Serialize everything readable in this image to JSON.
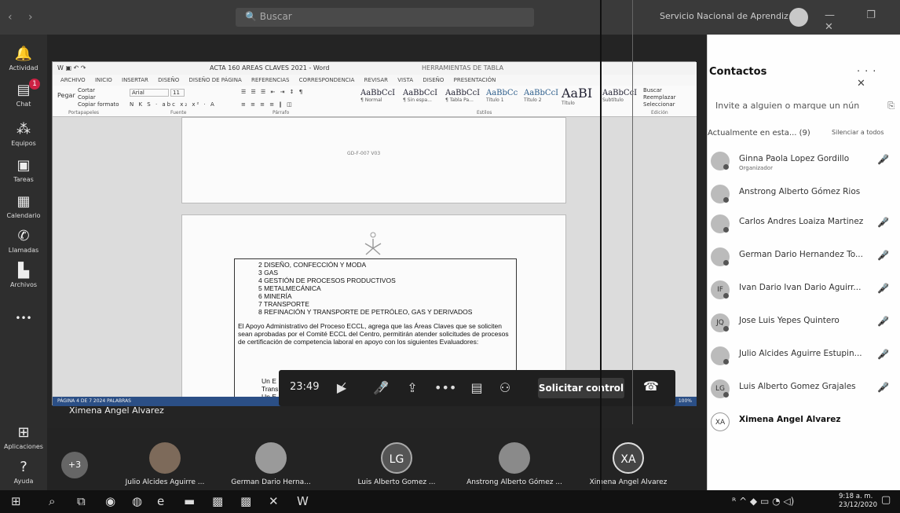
{
  "titlebar": {
    "search": "Buscar",
    "org": "Servicio Nacional de Aprendiz...",
    "nav": "‹ ›",
    "win": "— ❐ ✕"
  },
  "rail": {
    "items": [
      {
        "label": "Actividad",
        "icon": "bell-icon",
        "glyph": "🔔"
      },
      {
        "label": "Chat",
        "icon": "chat-icon",
        "glyph": "▤",
        "badge": "1"
      },
      {
        "label": "Equipos",
        "icon": "teams-icon",
        "glyph": "⁂"
      },
      {
        "label": "Tareas",
        "icon": "tasks-icon",
        "glyph": "▣"
      },
      {
        "label": "Calendario",
        "icon": "calendar-icon",
        "glyph": "▦"
      },
      {
        "label": "Llamadas",
        "icon": "phone-icon",
        "glyph": "✆"
      },
      {
        "label": "Archivos",
        "icon": "files-icon",
        "glyph": "▙"
      },
      {
        "label": "...",
        "icon": "more-icon",
        "glyph": "•••"
      }
    ],
    "apps": "Aplicaciones",
    "help": "Ayuda"
  },
  "word": {
    "title": "ACTA 160 AREAS CLAVES 2021 - Word",
    "tools": "HERRAMIENTAS DE TABLA",
    "menus": [
      "ARCHIVO",
      "INICIO",
      "INSERTAR",
      "DISEÑO",
      "DISEÑO DE PÁGINA",
      "REFERENCIAS",
      "CORRESPONDENCIA",
      "REVISAR",
      "VISTA",
      "DISEÑO",
      "PRESENTACIÓN"
    ],
    "clipboard": [
      "Cortar",
      "Copiar",
      "Copiar formato"
    ],
    "paste": "Pegar",
    "font": "Arial",
    "size": "11",
    "styles": [
      {
        "sample": "AaBbCcI",
        "name": "¶ Normal"
      },
      {
        "sample": "AaBbCcI",
        "name": "¶ Sin espa..."
      },
      {
        "sample": "AaBbCcI",
        "name": "¶ Tabla Pa..."
      },
      {
        "sample": "AaBbCc",
        "name": "Título 1"
      },
      {
        "sample": "AaBbCcI",
        "name": "Título 2"
      },
      {
        "sample": "AaBI",
        "name": "Título"
      },
      {
        "sample": "AaBbCcI",
        "name": "Subtítulo"
      }
    ],
    "edit": [
      "Buscar",
      "Reemplazar",
      "Seleccionar"
    ],
    "groups": [
      "Portapapeles",
      "Fuente",
      "Párrafo",
      "Estilos",
      "Edición"
    ],
    "list": [
      "2   DISEÑO, CONFECCIÓN Y MODA",
      "3   GAS",
      "4   GESTIÓN DE PROCESOS PRODUCTIVOS",
      "5   METALMECÁNICA",
      "6   MINERÍA",
      "7   TRANSPORTE",
      "8   REFINACIÓN Y TRANSPORTE DE PETRÓLEO, GAS Y DERIVADOS"
    ],
    "para": "El Apoyo Administrativo del Proceso ECCL, agrega que las Áreas Claves que se soliciten sean aprobadas por el Comité ECCL del Centro, permitirán atender solicitudes de procesos de certificación de competencia laboral en apoyo con los siguientes Evaluadores:",
    "tail": [
      "Un E",
      "Trans",
      "Un E"
    ],
    "code": "GD-F-007 V03",
    "status": "PÁGINA 4 DE 7    2024 PALABRAS",
    "zoom": "100%"
  },
  "controls": {
    "time": "23:49",
    "request": "Solicitar control"
  },
  "presenter": "Ximena Angel Alvarez",
  "participants": {
    "more": "+3",
    "list": [
      {
        "name": "Julio Alcides Aguirre ...",
        "initials": "",
        "mic": "🎤̸"
      },
      {
        "name": "German Dario Herna...",
        "initials": "",
        "mic": "🎤̸"
      },
      {
        "name": "Luis Alberto Gomez ...",
        "initials": "LG",
        "mic": "🎤̸"
      },
      {
        "name": "Anstrong Alberto Gómez ...",
        "initials": "",
        "mic": ""
      },
      {
        "name": "Ximena Angel Alvarez",
        "initials": "XA",
        "mic": ""
      }
    ]
  },
  "contacts": {
    "title": "Contactos",
    "actions": "··· ✕",
    "invite": "Invite a alguien o marque un nún",
    "current": "Actualmente en esta... (9)",
    "muteall": "Silenciar a todos",
    "people": [
      {
        "name": "Ginna Paola Lopez Gordillo",
        "sub": "Organizador",
        "initials": "",
        "muted": true
      },
      {
        "name": "Anstrong Alberto Gómez Rios",
        "sub": "",
        "initials": "",
        "muted": false
      },
      {
        "name": "Carlos Andres Loaiza Martinez",
        "sub": "",
        "initials": "",
        "muted": true
      },
      {
        "name": "German Dario Hernandez To...",
        "sub": "",
        "initials": "",
        "muted": true
      },
      {
        "name": "Ivan Dario Ivan Dario Aguirr...",
        "sub": "",
        "initials": "IF",
        "muted": true
      },
      {
        "name": "Jose Luis Yepes Quintero",
        "sub": "",
        "initials": "JQ",
        "muted": true
      },
      {
        "name": "Julio Alcides Aguirre Estupin...",
        "sub": "",
        "initials": "",
        "muted": true
      },
      {
        "name": "Luis Alberto Gomez Grajales",
        "sub": "",
        "initials": "LG",
        "muted": true
      },
      {
        "name": "Ximena Angel Alvarez",
        "sub": "",
        "initials": "XA",
        "muted": false
      }
    ]
  },
  "taskbar": {
    "time": "9:18 a. m.",
    "date": "23/12/2020"
  }
}
